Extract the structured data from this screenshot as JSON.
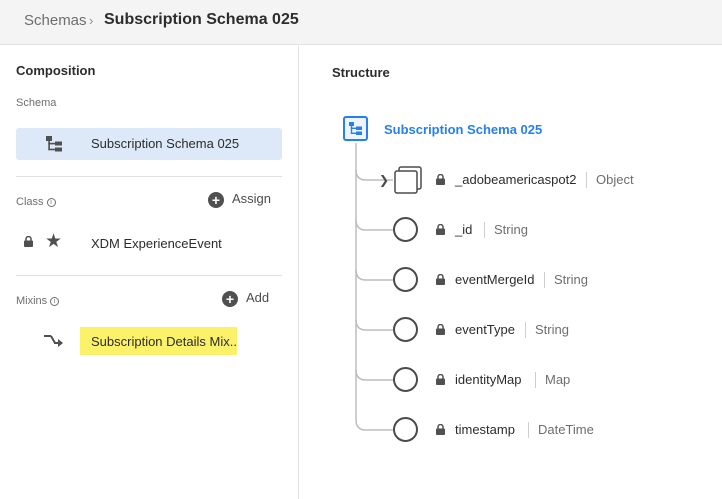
{
  "breadcrumb": {
    "root": "Schemas",
    "separator": "›",
    "current": "Subscription Schema 025"
  },
  "left": {
    "composition_title": "Composition",
    "schema_label": "Schema",
    "schema_name": "Subscription Schema 025",
    "class_label": "Class",
    "class_info_icon": "i",
    "assign_label": "Assign",
    "class_name": "XDM ExperienceEvent",
    "mixins_label": "Mixins",
    "mixins_info_icon": "i",
    "add_label": "Add",
    "mixin_name": "Subscription Details Mix..."
  },
  "right": {
    "structure_title": "Structure",
    "root_name": "Subscription Schema 025",
    "fields": [
      {
        "name": "_adobeamericaspot2",
        "type": "Object"
      },
      {
        "name": "_id",
        "type": "String"
      },
      {
        "name": "eventMergeId",
        "type": "String"
      },
      {
        "name": "eventType",
        "type": "String"
      },
      {
        "name": "identityMap",
        "type": "Map"
      },
      {
        "name": "timestamp",
        "type": "DateTime"
      }
    ]
  },
  "colors": {
    "accent": "#2680eb",
    "selected_bg": "#dde9f9",
    "highlight": "#fbf26a"
  },
  "icons": {
    "tree": "schema-tree-icon",
    "lock": "lock-icon",
    "star": "star-icon",
    "mixin": "mixin-arrow-icon",
    "plus": "add-circle-icon"
  }
}
